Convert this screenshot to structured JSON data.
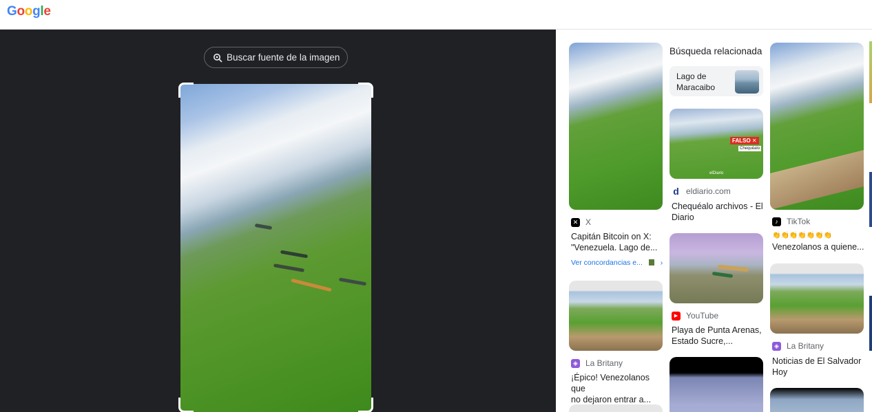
{
  "header": {
    "logo_letters": [
      "G",
      "o",
      "o",
      "g",
      "l",
      "e"
    ],
    "logo_colors": [
      "#4285f4",
      "#ea4335",
      "#fbbc05",
      "#4285f4",
      "#34a853",
      "#ea4335"
    ]
  },
  "search": {
    "source_button_label": "Buscar fuente de la imagen",
    "icon": "lens-search-icon"
  },
  "related": {
    "heading": "Búsqueda relacionada",
    "chip_label": "Lago de Maracaibo"
  },
  "results": [
    {
      "source": "X",
      "title_line1": "Capitán Bitcoin on X:",
      "title_line2": "\"Venezuela. Lago de...",
      "link": "Ver concordancias e..."
    },
    {
      "source": "eldiario.com",
      "title_line1": "Chequéalo archivos - El",
      "title_line2": "Diario",
      "badge": "FALSO ✕",
      "badge_sub": "Chequéalo",
      "watermark": "elDiario"
    },
    {
      "source": "TikTok",
      "emoji_line": "👏👏👏👏👏👏👏",
      "title_line2": "Venezolanos a quiene..."
    },
    {
      "source": "La Britany",
      "title_line1": "¡Épico! Venezolanos que",
      "title_line2": "no dejaron entrar a..."
    },
    {
      "source": "YouTube",
      "title_line1": "Playa de Punta Arenas,",
      "title_line2": "Estado Sucre,..."
    },
    {
      "source": "La Britany",
      "title_line1": "Noticias de El Salvador",
      "title_line2": "Hoy"
    }
  ]
}
